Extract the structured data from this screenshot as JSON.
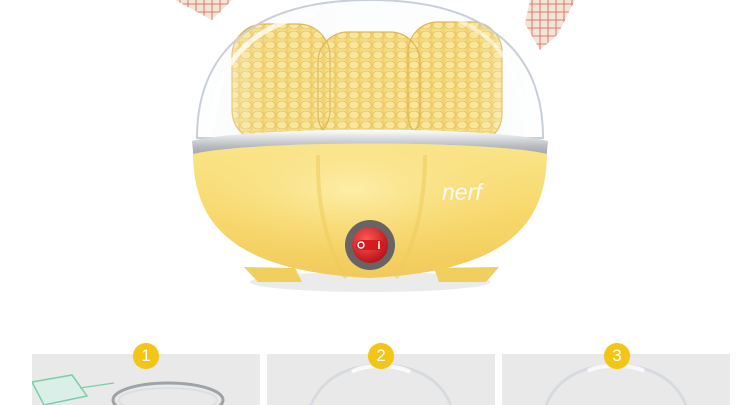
{
  "product": {
    "brand": "nerf",
    "colors": {
      "body": "#f7d96b",
      "corn": "#f8dd76",
      "switch": "#e11b22",
      "badge": "#f4c514"
    }
  },
  "steps": [
    {
      "number": "1"
    },
    {
      "number": "2"
    },
    {
      "number": "3"
    }
  ]
}
